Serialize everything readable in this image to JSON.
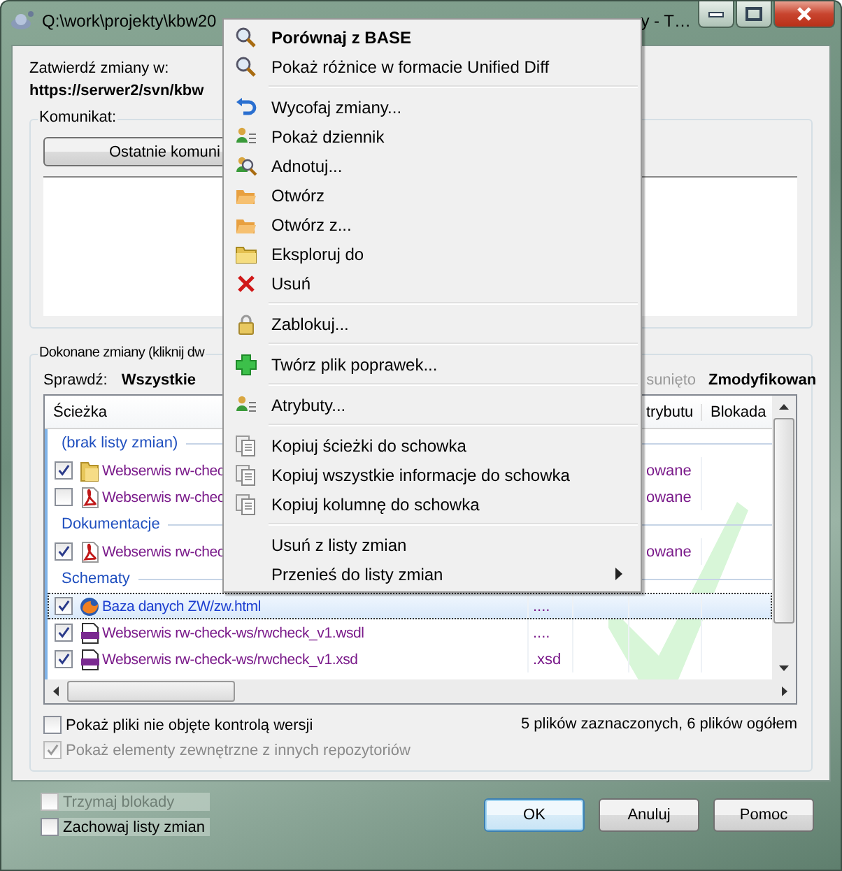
{
  "window": {
    "title_start": "Q:\\work\\projekty\\kbw20",
    "title_end": "y - T…"
  },
  "commit_to": {
    "label": "Zatwierdź zmiany w:",
    "url": "https://serwer2/svn/kbw"
  },
  "message": {
    "label": "Komunikat:",
    "recent_button": "Ostatnie komuni"
  },
  "changes": {
    "label": "Dokonane zmiany (kliknij dw",
    "filter_label": "Sprawdź:",
    "filters": [
      {
        "label": "Wszystkie",
        "available": true
      },
      {
        "label": "sunięto",
        "available": false
      },
      {
        "label": "Zmodyfikowan",
        "available": true
      }
    ],
    "columns": [
      {
        "label": "Ścieżka"
      },
      {
        "label": "trybutu"
      },
      {
        "label": "Blokada"
      }
    ],
    "groups": [
      {
        "name": "(brak listy zmian)",
        "rows": [
          {
            "kind": "folder",
            "checked": true,
            "selected": false,
            "color": "#7a1a8a",
            "path": "Webserwis rw-chec",
            "status": "owane"
          },
          {
            "kind": "pdf",
            "checked": false,
            "selected": false,
            "color": "#7a1a8a",
            "path": "Webserwis rw-chec",
            "status": "owane"
          }
        ]
      },
      {
        "name": "Dokumentacje",
        "rows": [
          {
            "kind": "pdf",
            "checked": true,
            "selected": false,
            "color": "#7a1a8a",
            "path": "Webserwis rw-chec",
            "status": "owane"
          }
        ]
      },
      {
        "name": "Schematy",
        "rows": [
          {
            "kind": "web",
            "checked": true,
            "selected": true,
            "color": "#1c3ed0",
            "path": "Baza danych ZW/zw.html",
            "extension": "...."
          },
          {
            "kind": "wsdl",
            "checked": true,
            "selected": false,
            "color": "#7a1a8a",
            "path": "Webserwis rw-check-ws/rwcheck_v1.wsdl",
            "extension": "...."
          },
          {
            "kind": "xsd",
            "checked": true,
            "selected": false,
            "color": "#7a1a8a",
            "path": "Webserwis rw-check-ws/rwcheck_v1.xsd",
            "extension": ".xsd"
          }
        ]
      }
    ],
    "options": [
      {
        "label": "Pokaż pliki nie objęte kontrolą wersji",
        "checked": false,
        "disabled": false
      },
      {
        "label": "Pokaż elementy zewnętrzne z innych repozytoriów",
        "checked": true,
        "disabled": true
      }
    ],
    "summary": "5 plików zaznaczonych, 6 plików ogółem"
  },
  "footer_options": [
    {
      "label": "Trzymaj blokady",
      "checked": false,
      "disabled": true
    },
    {
      "label": "Zachowaj listy zmian",
      "checked": false,
      "disabled": false
    }
  ],
  "buttons": [
    {
      "label": "OK",
      "default": true
    },
    {
      "label": "Anuluj",
      "default": false
    },
    {
      "label": "Pomoc",
      "default": false
    }
  ],
  "context_menu": [
    {
      "kind": "compare",
      "label": "Porównaj z BASE",
      "default": true
    },
    {
      "kind": "compare",
      "label": "Pokaż różnice w formacie Unified Diff",
      "default": false
    },
    {
      "kind": "separator"
    },
    {
      "kind": "revert",
      "label": "Wycofaj zmiany...",
      "default": false
    },
    {
      "kind": "log",
      "label": "Pokaż dziennik",
      "default": false
    },
    {
      "kind": "annotate",
      "label": "Adnotuj...",
      "default": false
    },
    {
      "kind": "open",
      "label": "Otwórz",
      "default": false
    },
    {
      "kind": "open",
      "label": "Otwórz z...",
      "default": false
    },
    {
      "kind": "explore",
      "label": "Eksploruj do",
      "default": false
    },
    {
      "kind": "delete",
      "label": "Usuń",
      "default": false
    },
    {
      "kind": "separator"
    },
    {
      "kind": "lock",
      "label": "Zablokuj...",
      "default": false
    },
    {
      "kind": "separator"
    },
    {
      "kind": "patch",
      "label": "Twórz plik poprawek...",
      "default": false
    },
    {
      "kind": "separator"
    },
    {
      "kind": "log",
      "label": "Atrybuty...",
      "default": false
    },
    {
      "kind": "separator"
    },
    {
      "kind": "copy",
      "label": "Kopiuj ścieżki do schowka",
      "default": false
    },
    {
      "kind": "copy",
      "label": "Kopiuj wszystkie informacje do schowka",
      "default": false
    },
    {
      "kind": "copy",
      "label": "Kopiuj kolumnę do schowka",
      "default": false
    },
    {
      "kind": "separator"
    },
    {
      "kind": "plain",
      "label": "Usuń z listy zmian",
      "default": false
    },
    {
      "kind": "plain",
      "label": "Przenieś do listy zmian",
      "default": false,
      "submenu": true
    }
  ]
}
